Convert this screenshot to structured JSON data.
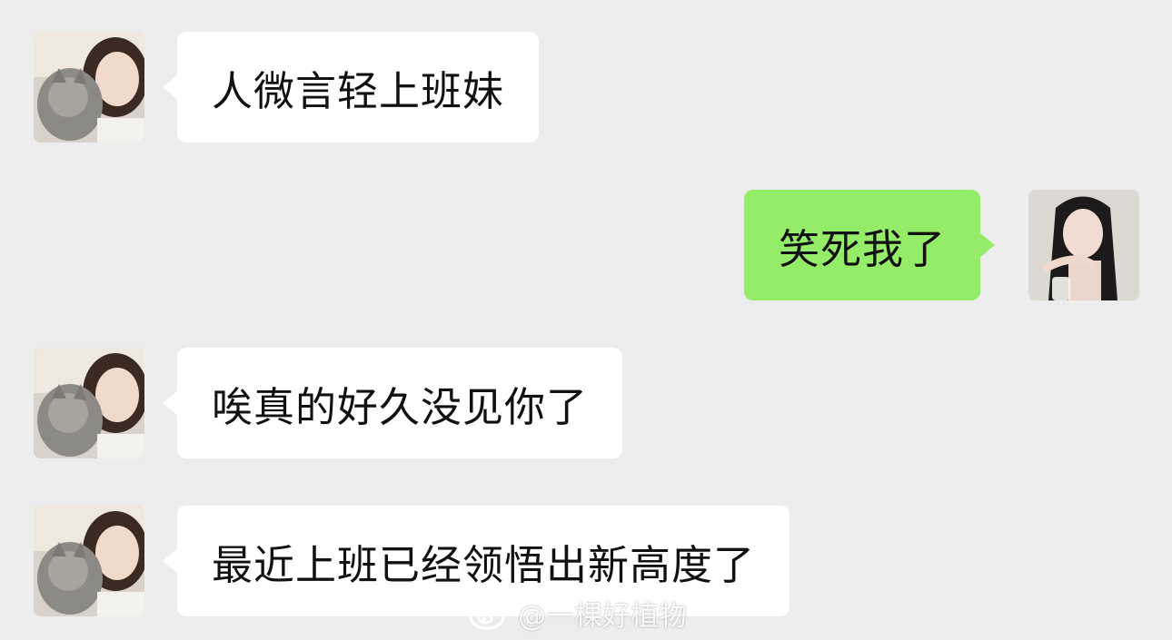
{
  "messages": [
    {
      "sender": "contact",
      "text": "人微言轻上班妹"
    },
    {
      "sender": "me",
      "text": "笑死我了"
    },
    {
      "sender": "contact",
      "text": "唉真的好久没见你了"
    },
    {
      "sender": "contact",
      "text": "最近上班已经领悟出新高度了"
    }
  ],
  "watermark": {
    "icon": "weibo-logo-icon",
    "text": "@一棵好植物"
  },
  "colors": {
    "background": "#ededed",
    "incoming_bubble": "#ffffff",
    "outgoing_bubble": "#95ec69"
  }
}
